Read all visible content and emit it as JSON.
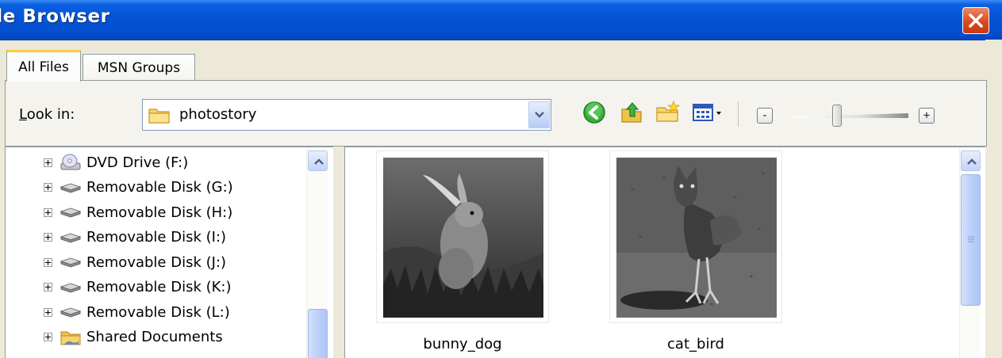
{
  "window": {
    "title": "ile Browser",
    "close_icon": "close-icon"
  },
  "tabs": [
    {
      "label": "All Files",
      "active": true
    },
    {
      "label": "MSN Groups",
      "active": false
    }
  ],
  "toolbar": {
    "look_in_label": "Look in:",
    "look_in_accesskey": "L",
    "look_in_rest": "ook in:",
    "location_value": "photostory",
    "icons": [
      "back-icon",
      "up-folder-icon",
      "new-folder-icon",
      "view-menu-icon"
    ],
    "zoom_out_label": "-",
    "zoom_in_label": "+",
    "zoom_level": 0.38
  },
  "tree": {
    "items": [
      {
        "label": "DVD Drive (F:)",
        "icon": "dvd-drive-icon"
      },
      {
        "label": "Removable Disk (G:)",
        "icon": "removable-disk-icon"
      },
      {
        "label": "Removable Disk (H:)",
        "icon": "removable-disk-icon"
      },
      {
        "label": "Removable Disk (I:)",
        "icon": "removable-disk-icon"
      },
      {
        "label": "Removable Disk (J:)",
        "icon": "removable-disk-icon"
      },
      {
        "label": "Removable Disk (K:)",
        "icon": "removable-disk-icon"
      },
      {
        "label": "Removable Disk (L:)",
        "icon": "removable-disk-icon"
      },
      {
        "label": "Shared Documents",
        "icon": "shared-folder-icon"
      }
    ]
  },
  "files": [
    {
      "name": "bunny_dog",
      "image": "bunny-dog-photo"
    },
    {
      "name": "cat_bird",
      "image": "cat-bird-photo"
    }
  ]
}
